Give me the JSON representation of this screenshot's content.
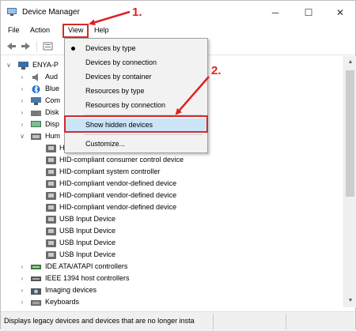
{
  "window": {
    "title": "Device Manager",
    "minimize_glyph": "─",
    "maximize_glyph": "☐",
    "close_glyph": "✕"
  },
  "menu": {
    "file": "File",
    "action": "Action",
    "view": "View",
    "help": "Help"
  },
  "tree": {
    "root": "ENYA-P",
    "categories_top": [
      {
        "label": "Aud",
        "icon": "audio-icon"
      },
      {
        "label": "Blue",
        "icon": "bluetooth-icon"
      },
      {
        "label": "Com",
        "icon": "computer-icon"
      },
      {
        "label": "Disk",
        "icon": "disk-icon"
      },
      {
        "label": "Disp",
        "icon": "display-icon"
      },
      {
        "label": "Hum",
        "icon": "hid-icon"
      }
    ],
    "hid_children": [
      "H",
      "HID-compliant consumer control device",
      "HID-compliant system controller",
      "HID-compliant vendor-defined device",
      "HID-compliant vendor-defined device",
      "HID-compliant vendor-defined device",
      "USB Input Device",
      "USB Input Device",
      "USB Input Device",
      "USB Input Device"
    ],
    "categories_bottom": [
      {
        "label": "IDE ATA/ATAPI controllers",
        "icon": "ide-icon"
      },
      {
        "label": "IEEE 1394 host controllers",
        "icon": "ieee1394-icon"
      },
      {
        "label": "Imaging devices",
        "icon": "imaging-icon"
      },
      {
        "label": "Keyboards",
        "icon": "keyboard-icon"
      }
    ]
  },
  "view_menu": {
    "items_group1": [
      "Devices by type",
      "Devices by connection",
      "Devices by container",
      "Resources by type",
      "Resources by connection"
    ],
    "show_hidden": "Show hidden devices",
    "customize": "Customize..."
  },
  "annotations": {
    "step1": "1.",
    "step2": "2.",
    "color": "#e02020"
  },
  "status_bar": {
    "text": "Displays legacy devices and devices that are no longer insta"
  },
  "colors": {
    "selected_menu_bg": "#cce4f7",
    "highlight_red": "#d32b2b"
  }
}
